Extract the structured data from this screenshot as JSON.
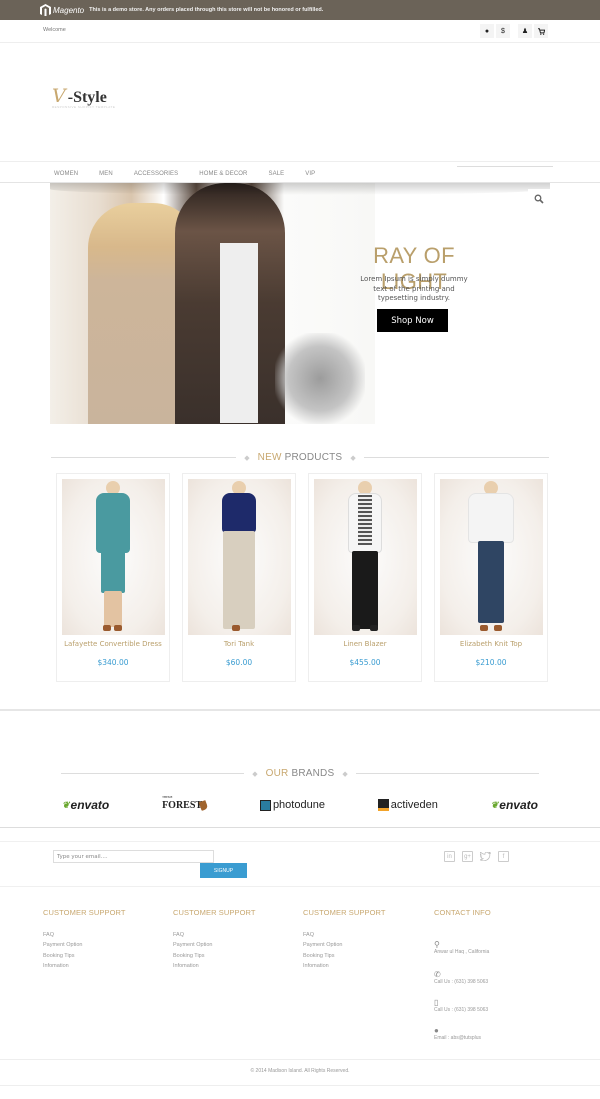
{
  "demo_notice": {
    "logo_text": "Magento",
    "message": "This is a demo store. Any orders placed through this store will not be honored or fulfilled."
  },
  "top_bar": {
    "welcome": "Welcome",
    "icons": [
      {
        "name": "language-globe-icon",
        "glyph": "●"
      },
      {
        "name": "currency-dollar-icon",
        "glyph": "$"
      },
      {
        "name": "account-user-icon",
        "glyph": "♟"
      },
      {
        "name": "cart-icon",
        "glyph": "🛒"
      }
    ]
  },
  "logo": {
    "mark": "V",
    "name": "-Style",
    "tagline": "RESPONSIVE SHOPIFY TEMPLATE"
  },
  "nav": {
    "items": [
      "WOMEN",
      "MEN",
      "ACCESSORIES",
      "HOME & DECOR",
      "SALE",
      "VIP"
    ]
  },
  "hero": {
    "title": "RAY OF LIGHT",
    "text": "Lorem Ipsum is simply dummy text of the printing and typesetting industry.",
    "button": "Shop Now",
    "search_glyph": "⚲"
  },
  "new_products": {
    "title_accent": "NEW",
    "title_rest": " PRODUCTS",
    "items": [
      {
        "name": "Lafayette Convertible Dress",
        "price": "$340.00",
        "colors": {
          "top": "#4a9aa0",
          "bottom": "#4a9aa0",
          "shoe": "#9a5a2e"
        }
      },
      {
        "name": "Tori Tank",
        "price": "$60.00",
        "colors": {
          "top": "#1e2a6a",
          "bottom": "#d8cfbf",
          "shoe": "#9a5a2e"
        }
      },
      {
        "name": "Linen Blazer",
        "price": "$455.00",
        "colors": {
          "top": "#f6f6f6",
          "bottom": "#1a1a1a",
          "shoe": "#222222"
        }
      },
      {
        "name": "Elizabeth Knit Top",
        "price": "$210.00",
        "colors": {
          "top": "#f4f4f4",
          "bottom": "#2f4563",
          "shoe": "#9a5a2e"
        }
      }
    ]
  },
  "brands": {
    "title_accent": "OUR",
    "title_rest": " BRANDS",
    "items": [
      {
        "name": "envato"
      },
      {
        "name": "FOREST",
        "prefix": "THEME"
      },
      {
        "name": "photodune"
      },
      {
        "name": "activeden"
      },
      {
        "name": "envato"
      }
    ]
  },
  "newsletter": {
    "placeholder": "Type your email....",
    "button": "SIGNUP",
    "social": [
      {
        "name": "linkedin-icon",
        "glyph": "in"
      },
      {
        "name": "google-plus-icon",
        "glyph": "g+"
      },
      {
        "name": "twitter-icon",
        "glyph": "🐦"
      },
      {
        "name": "facebook-icon",
        "glyph": "f"
      }
    ]
  },
  "footer": {
    "columns": [
      {
        "title": "CUSTOMER SUPPORT",
        "links": [
          "FAQ",
          "Payment Option",
          "Booking Tips",
          "Infomation"
        ]
      },
      {
        "title": "CUSTOMER SUPPORT",
        "links": [
          "FAQ",
          "Payment Option",
          "Booking Tips",
          "Infomation"
        ]
      },
      {
        "title": "CUSTOMER SUPPORT",
        "links": [
          "FAQ",
          "Payment Option",
          "Booking Tips",
          "Infomation"
        ]
      }
    ],
    "contact": {
      "title": "CONTACT INFO",
      "items": [
        {
          "icon": "map-pin-icon",
          "glyph": "⚲",
          "text": "Anwar ul Haq , California"
        },
        {
          "icon": "phone-icon",
          "glyph": "✆",
          "text": "Call Us : (631) 398 5063"
        },
        {
          "icon": "mobile-icon",
          "glyph": "▯",
          "text": "Call Us : (631) 398 5063"
        },
        {
          "icon": "email-icon",
          "glyph": "●",
          "text": "Email : abs@tutsplus"
        }
      ]
    },
    "copyright": "© 2014 Madison Island. All Rights Reserved."
  }
}
